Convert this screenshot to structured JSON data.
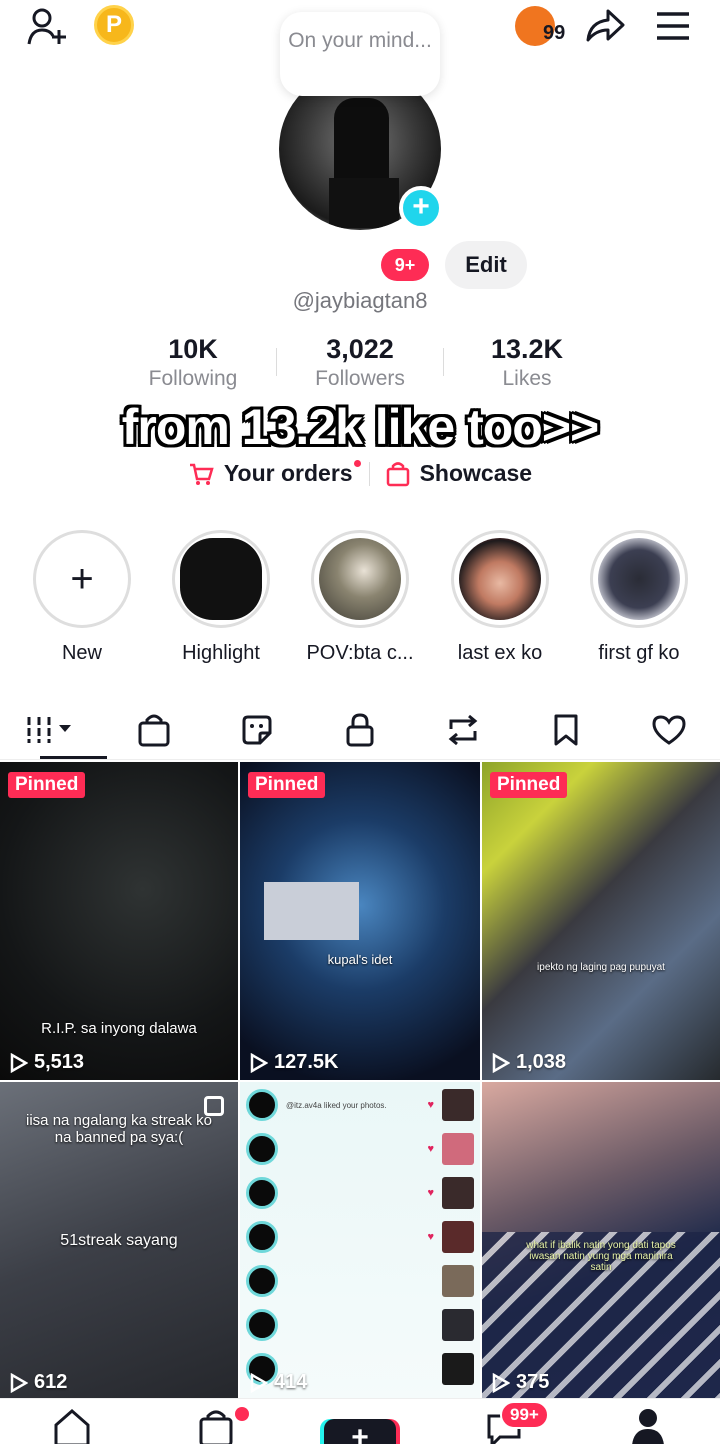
{
  "header": {
    "thought_bubble": "On your mind...",
    "points_coin": "P",
    "coin_badge": "99",
    "notif_badge": "9+",
    "edit_label": "Edit",
    "username": "@jaybiagtan8"
  },
  "stats": [
    {
      "value": "10K",
      "label": "Following"
    },
    {
      "value": "3,022",
      "label": "Followers"
    },
    {
      "value": "13.2K",
      "label": "Likes"
    }
  ],
  "bio": "from 13.2k like too>>",
  "links": {
    "orders": "Your orders",
    "showcase": "Showcase"
  },
  "highlights": [
    {
      "label": "New"
    },
    {
      "label": "Highlight"
    },
    {
      "label": "POV:bta c..."
    },
    {
      "label": "last ex ko"
    },
    {
      "label": "first gf ko"
    }
  ],
  "tabs": [
    "videos-icon",
    "shop-icon",
    "stickers-icon",
    "lock-icon",
    "repost-icon",
    "bookmark-icon",
    "heart-icon"
  ],
  "videos": [
    {
      "pinned": "Pinned",
      "views": "5,513",
      "caption": "R.I.P. sa inyong dalawa"
    },
    {
      "pinned": "Pinned",
      "views": "127.5K",
      "caption": "kupal's idet"
    },
    {
      "pinned": "Pinned",
      "views": "1,038",
      "caption": "ipekto ng laging pag pupuyat"
    },
    {
      "views": "612",
      "caption": "iisa na ngalang ka streak ko na banned pa sya:(",
      "caption2": "51streak sayang"
    },
    {
      "views": "414",
      "caption": "@itz.av4a liked your photos."
    },
    {
      "views": "375",
      "caption": "what if ibalik natin yong dati tapos iwasan natin yung mga maninira satin"
    }
  ],
  "bottom_nav": {
    "inbox_badge": "99+"
  },
  "colors": {
    "accent_red": "#fe2c55",
    "accent_cyan": "#20d5ec"
  }
}
